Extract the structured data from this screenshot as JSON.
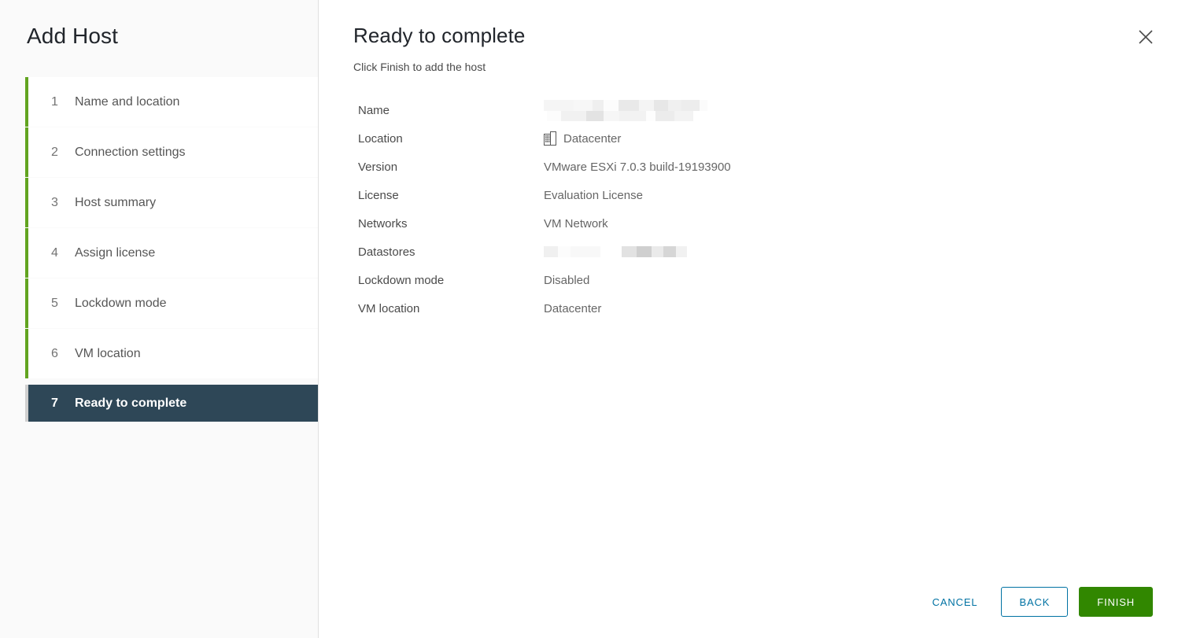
{
  "wizard": {
    "title": "Add Host",
    "steps": [
      {
        "num": "1",
        "label": "Name and location"
      },
      {
        "num": "2",
        "label": "Connection settings"
      },
      {
        "num": "3",
        "label": "Host summary"
      },
      {
        "num": "4",
        "label": "Assign license"
      },
      {
        "num": "5",
        "label": "Lockdown mode"
      },
      {
        "num": "6",
        "label": "VM location"
      },
      {
        "num": "7",
        "label": "Ready to complete"
      }
    ],
    "active_step_index": 6,
    "accent_color": "#62a420",
    "active_step_bg": "#2e4757"
  },
  "page": {
    "title": "Ready to complete",
    "subtitle": "Click Finish to add the host",
    "close_icon": "close-icon"
  },
  "summary": {
    "rows": [
      {
        "label": "Name",
        "value": "",
        "redacted": true,
        "icon": ""
      },
      {
        "label": "Location",
        "value": "Datacenter",
        "redacted": false,
        "icon": "datacenter-icon"
      },
      {
        "label": "Version",
        "value": "VMware ESXi 7.0.3 build-19193900",
        "redacted": false,
        "icon": ""
      },
      {
        "label": "License",
        "value": "Evaluation License",
        "redacted": false,
        "icon": ""
      },
      {
        "label": "Networks",
        "value": "VM Network",
        "redacted": false,
        "icon": ""
      },
      {
        "label": "Datastores",
        "value": "",
        "redacted": true,
        "icon": ""
      },
      {
        "label": "Lockdown mode",
        "value": "Disabled",
        "redacted": false,
        "icon": ""
      },
      {
        "label": "VM location",
        "value": "Datacenter",
        "redacted": false,
        "icon": ""
      }
    ]
  },
  "footer": {
    "cancel_label": "Cancel",
    "back_label": "Back",
    "finish_label": "Finish",
    "link_color": "#0072a3",
    "finish_color": "#318700"
  }
}
